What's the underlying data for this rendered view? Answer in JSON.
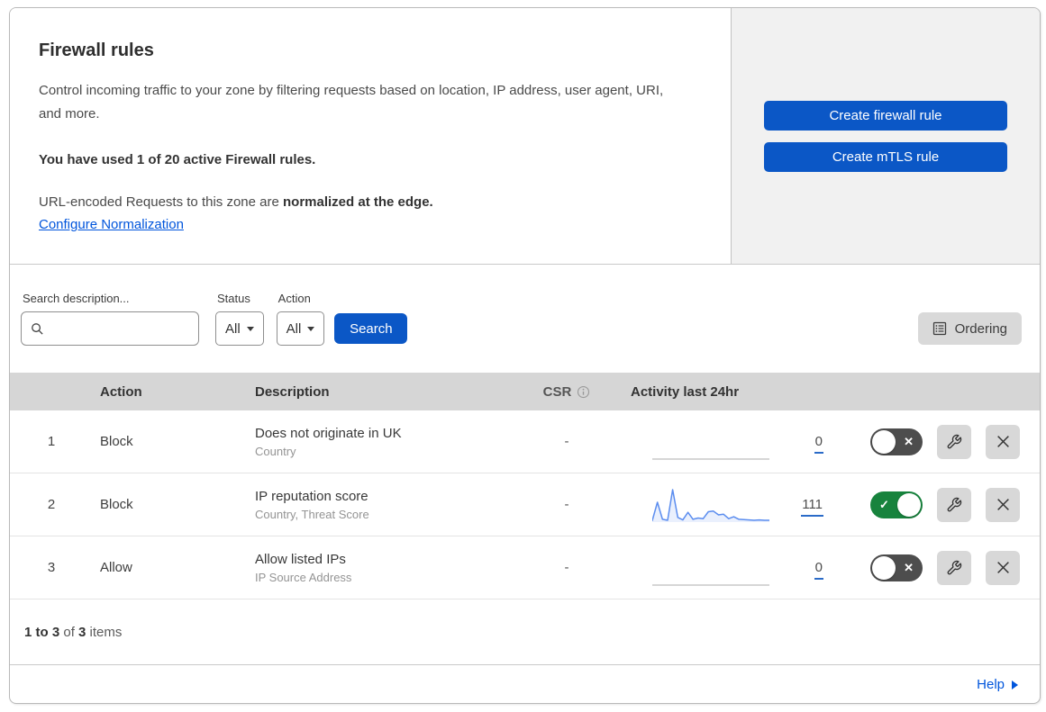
{
  "header": {
    "title": "Firewall rules",
    "description": "Control incoming traffic to your zone by filtering requests based on location, IP address, user agent, URI, and more.",
    "usage_bold": "You have used 1 of 20 active Firewall rules.",
    "normalization_prefix": "URL-encoded Requests to this zone are ",
    "normalization_bold": "normalized at the edge.",
    "normalization_link": "Configure Normalization"
  },
  "actions_panel": {
    "create_firewall_label": "Create firewall rule",
    "create_mtls_label": "Create mTLS rule"
  },
  "filters": {
    "search_label": "Search description...",
    "search_value": "",
    "status_label": "Status",
    "status_value": "All",
    "action_label": "Action",
    "action_value": "All",
    "search_button": "Search",
    "ordering_button": "Ordering"
  },
  "table": {
    "columns": {
      "action": "Action",
      "description": "Description",
      "csr": "CSR",
      "activity": "Activity last 24hr"
    },
    "rows": [
      {
        "priority": "1",
        "action": "Block",
        "description": "Does not originate in UK",
        "criteria": "Country",
        "csr": "-",
        "activity_count": "0",
        "enabled": false,
        "sparkline": [
          0,
          0,
          0,
          0,
          0,
          0,
          0,
          0,
          0,
          0,
          0,
          0,
          0,
          0,
          0,
          0,
          0,
          0,
          0,
          0,
          0,
          0,
          0,
          0
        ]
      },
      {
        "priority": "2",
        "action": "Block",
        "description": "IP reputation score",
        "criteria": "Country, Threat Score",
        "csr": "-",
        "activity_count": "111",
        "enabled": true,
        "sparkline": [
          2,
          60,
          6,
          3,
          100,
          12,
          4,
          28,
          6,
          10,
          8,
          30,
          32,
          20,
          22,
          8,
          14,
          6,
          5,
          4,
          3,
          4,
          3,
          3
        ]
      },
      {
        "priority": "3",
        "action": "Allow",
        "description": "Allow listed IPs",
        "criteria": "IP Source Address",
        "csr": "-",
        "activity_count": "0",
        "enabled": false,
        "sparkline": [
          0,
          0,
          0,
          0,
          0,
          0,
          0,
          0,
          0,
          0,
          0,
          0,
          0,
          0,
          0,
          0,
          0,
          0,
          0,
          0,
          0,
          0,
          0,
          0
        ]
      }
    ]
  },
  "footer": {
    "range_bold": "1 to 3",
    "of_text": " of ",
    "total_bold": "3",
    "items_text": " items"
  },
  "help": {
    "label": "Help"
  },
  "icons": {
    "toggle_check": "✓",
    "toggle_x": "✕"
  },
  "colors": {
    "accent_blue": "#0b57c6",
    "link_blue": "#0055dc",
    "toggle_on_green": "#17833d",
    "toggle_off_gray": "#4d4d4d",
    "sparkline_blue": "#5b8def",
    "sparkline_fill": "rgba(91,141,239,0.13)",
    "sparkline_flat_gray": "#c8c8c8",
    "panel_gray": "#f1f1f1",
    "table_header_gray": "#d6d6d6"
  }
}
